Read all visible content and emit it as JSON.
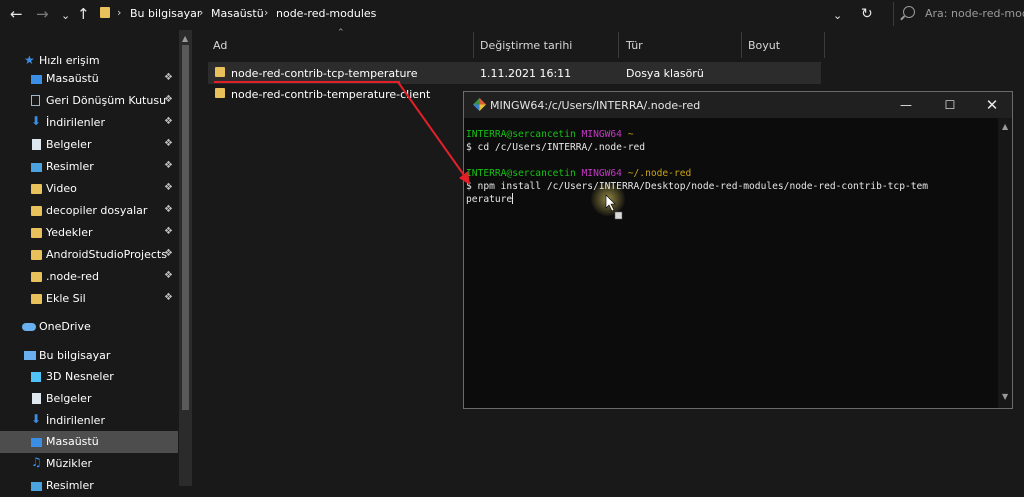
{
  "addressbar": {
    "back_icon": "arrow-left-icon",
    "forward_icon": "arrow-right-icon",
    "recent_icon": "chevron-down-icon",
    "up_icon": "arrow-up-icon",
    "breadcrumbs": [
      "Bu bilgisayar",
      "Masaüstü",
      "node-red-modules"
    ],
    "search_placeholder": "Ara: node-red-modu"
  },
  "sidebar": {
    "quick_access": "Hızlı erişim",
    "pinned_items": [
      {
        "label": "Masaüstü",
        "icon": "desktop-icon"
      },
      {
        "label": "Geri Dönüşüm Kutusu",
        "icon": "recycle-bin-icon"
      },
      {
        "label": "İndirilenler",
        "icon": "download-icon"
      },
      {
        "label": "Belgeler",
        "icon": "documents-icon"
      },
      {
        "label": "Resimler",
        "icon": "pictures-icon"
      },
      {
        "label": "Video",
        "icon": "folder-icon"
      },
      {
        "label": "decopiler dosyalar",
        "icon": "folder-icon"
      },
      {
        "label": "Yedekler",
        "icon": "folder-icon"
      },
      {
        "label": "AndroidStudioProjects",
        "icon": "folder-icon"
      },
      {
        "label": ".node-red",
        "icon": "folder-icon"
      },
      {
        "label": "Ekle Sil",
        "icon": "folder-icon"
      }
    ],
    "onedrive": "OneDrive",
    "this_pc": "Bu bilgisayar",
    "pc_items": [
      {
        "label": "3D Nesneler",
        "icon": "3d-objects-icon"
      },
      {
        "label": "Belgeler",
        "icon": "documents-icon"
      },
      {
        "label": "İndirilenler",
        "icon": "download-icon"
      },
      {
        "label": "Masaüstü",
        "icon": "desktop-icon",
        "selected": true
      },
      {
        "label": "Müzikler",
        "icon": "music-icon"
      },
      {
        "label": "Resimler",
        "icon": "pictures-icon"
      }
    ]
  },
  "filelist": {
    "columns": [
      "Ad",
      "Değiştirme tarihi",
      "Tür",
      "Boyut"
    ],
    "rows": [
      {
        "name": "node-red-contrib-tcp-temperature",
        "date": "1.11.2021 16:11",
        "type": "Dosya klasörü"
      },
      {
        "name": "node-red-contrib-temperature-client",
        "date": "",
        "type": ""
      }
    ]
  },
  "terminal": {
    "title": "MINGW64:/c/Users/INTERRA/.node-red",
    "lines": [
      {
        "user": "INTERRA@sercancetin",
        "host": "MINGW64",
        "path": "~"
      },
      {
        "cmd": "$ cd /c/Users/INTERRA/.node-red"
      },
      {
        "blank": ""
      },
      {
        "user": "INTERRA@sercancetin",
        "host": "MINGW64",
        "path": "~/.node-red"
      },
      {
        "cmd": "$ npm install /c/Users/INTERRA/Desktop/node-red-modules/node-red-contrib-tcp-tem"
      },
      {
        "cmd": "perature"
      }
    ]
  },
  "colors": {
    "background": "#191919",
    "selected": "#4d4d4d",
    "folder": "#e8c15a",
    "annotation_red": "#e3202a",
    "prompt_green": "#18c016",
    "prompt_magenta": "#c43ac4",
    "prompt_yellow": "#c8a317"
  }
}
